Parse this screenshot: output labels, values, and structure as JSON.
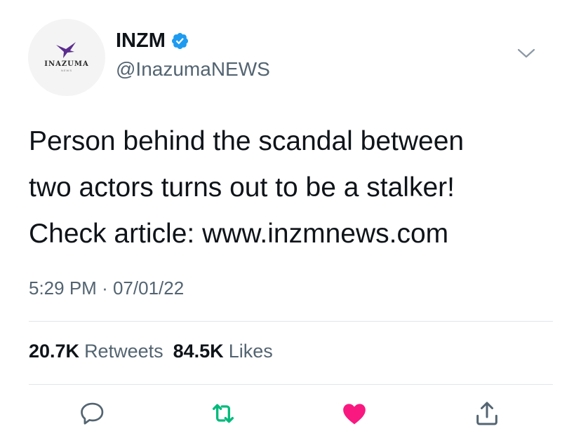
{
  "account": {
    "display_name": "INZM",
    "handle": "@InazumaNEWS",
    "verified": true,
    "avatar_logo_text": "INAZUMA",
    "avatar_logo_subtext": "NEWS"
  },
  "tweet": {
    "lines": [
      "Person behind the scandal between",
      "two actors turns out to be a stalker!",
      "Check article: www.inzmnews.com"
    ],
    "time": "5:29 PM",
    "separator": "·",
    "date": "07/01/22"
  },
  "stats": {
    "retweets_count": "20.7K",
    "retweets_label": "Retweets",
    "likes_count": "84.5K",
    "likes_label": "Likes"
  },
  "colors": {
    "verified": "#1d9bf0",
    "retweet_active": "#00ba7c",
    "like_active": "#f91880",
    "muted": "#536471"
  },
  "icons": [
    "chevron-down-icon",
    "verified-badge-icon",
    "reply-icon",
    "retweet-icon",
    "like-icon",
    "share-icon"
  ]
}
